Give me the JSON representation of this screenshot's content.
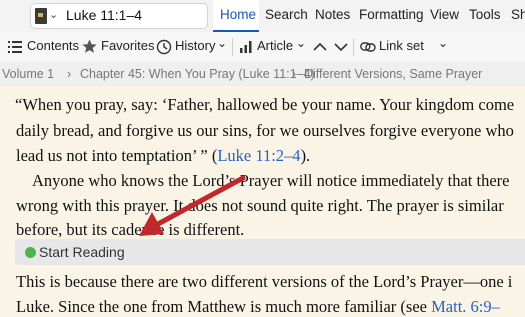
{
  "header": {
    "resource_title": "Luke 11:1–4",
    "tabs": [
      "Home",
      "Search",
      "Notes",
      "Formatting",
      "View",
      "Tools",
      "Sh"
    ],
    "active_tab": "Home"
  },
  "toolbar": {
    "contents": "Contents",
    "favorites": "Favorites",
    "history": "History",
    "article": "Article",
    "link_set": "Link set"
  },
  "breadcrumb": {
    "volume": "Volume 1",
    "chapter": "Chapter 45: When You Pray (Luke 11:1–4)",
    "section": "Different Versions, Same Prayer"
  },
  "reading": {
    "line1": "“When you pray, say: ‘Father, hallowed be your name. Your kingdom come",
    "line2": "daily bread, and forgive us our sins, for we ourselves forgive everyone who",
    "line3_text": "lead us not into temptation’ ” (",
    "line3_link": "Luke 11:2–4",
    "line3_end": ").",
    "line4": "Anyone who knows the Lord’s Prayer will notice immediately that there",
    "line5": "wrong with this prayer. It does not sound quite right. The prayer is similar",
    "line6": "before, but its cadence is different.",
    "start_reading": "Start Reading",
    "line7": "This is because there are two different versions of the Lord’s Prayer—one i",
    "line8_text": "Luke. Since the one from Matthew is much more familiar (see ",
    "line8_link": "Matt. 6:9–"
  },
  "colors": {
    "accent": "#1a55b8",
    "link": "#2860c4",
    "arrow": "#c0282b",
    "reading_background": "#faf4e6",
    "status_dot": "#4db54a"
  }
}
